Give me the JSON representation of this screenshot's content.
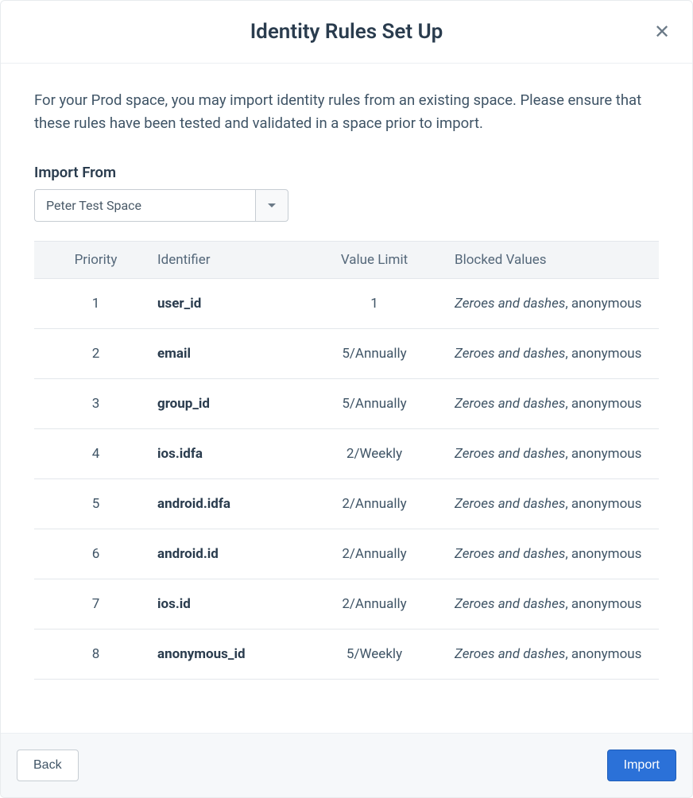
{
  "header": {
    "title": "Identity Rules Set Up"
  },
  "description": "For your Prod space, you may import identity rules from an existing space. Please ensure that these rules have been tested and validated in a space prior to import.",
  "import_from": {
    "label": "Import From",
    "selected": "Peter Test Space"
  },
  "table": {
    "headers": {
      "priority": "Priority",
      "identifier": "Identifier",
      "value_limit": "Value Limit",
      "blocked_values": "Blocked Values"
    },
    "rows": [
      {
        "priority": "1",
        "identifier": "user_id",
        "value_limit": "1",
        "blocked_italic": "Zeroes and dashes",
        "blocked_rest": ", anonymous"
      },
      {
        "priority": "2",
        "identifier": "email",
        "value_limit": "5/Annually",
        "blocked_italic": "Zeroes and dashes",
        "blocked_rest": ", anonymous"
      },
      {
        "priority": "3",
        "identifier": "group_id",
        "value_limit": "5/Annually",
        "blocked_italic": "Zeroes and dashes",
        "blocked_rest": ", anonymous"
      },
      {
        "priority": "4",
        "identifier": "ios.idfa",
        "value_limit": "2/Weekly",
        "blocked_italic": "Zeroes and dashes",
        "blocked_rest": ", anonymous"
      },
      {
        "priority": "5",
        "identifier": "android.idfa",
        "value_limit": "2/Annually",
        "blocked_italic": "Zeroes and dashes",
        "blocked_rest": ", anonymous"
      },
      {
        "priority": "6",
        "identifier": "android.id",
        "value_limit": "2/Annually",
        "blocked_italic": "Zeroes and dashes",
        "blocked_rest": ", anonymous"
      },
      {
        "priority": "7",
        "identifier": "ios.id",
        "value_limit": "2/Annually",
        "blocked_italic": "Zeroes and dashes",
        "blocked_rest": ", anonymous"
      },
      {
        "priority": "8",
        "identifier": "anonymous_id",
        "value_limit": "5/Weekly",
        "blocked_italic": "Zeroes and dashes",
        "blocked_rest": ", anonymous"
      }
    ]
  },
  "footer": {
    "back": "Back",
    "import": "Import"
  }
}
